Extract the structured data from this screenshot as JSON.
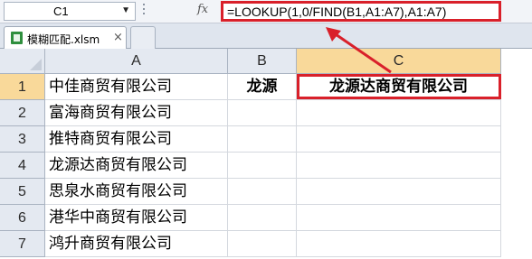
{
  "formula_bar": {
    "name_box": "C1",
    "dropdown_glyph": "▼",
    "fx_label": "fx",
    "formula": "=LOOKUP(1,0/FIND(B1,A1:A7),A1:A7)"
  },
  "tabs": {
    "active": {
      "label": "模糊匹配.xlsm",
      "close_glyph": "×"
    }
  },
  "columns": [
    "A",
    "B",
    "C"
  ],
  "rows": [
    {
      "num": "1",
      "A": "中佳商贸有限公司",
      "B": "龙源",
      "C": "龙源达商贸有限公司"
    },
    {
      "num": "2",
      "A": "富海商贸有限公司",
      "B": "",
      "C": ""
    },
    {
      "num": "3",
      "A": "推特商贸有限公司",
      "B": "",
      "C": ""
    },
    {
      "num": "4",
      "A": "龙源达商贸有限公司",
      "B": "",
      "C": ""
    },
    {
      "num": "5",
      "A": "思泉水商贸有限公司",
      "B": "",
      "C": ""
    },
    {
      "num": "6",
      "A": "港华中商贸有限公司",
      "B": "",
      "C": ""
    },
    {
      "num": "7",
      "A": "鸿升商贸有限公司",
      "B": "",
      "C": ""
    }
  ],
  "selected_cell": "C1",
  "colors": {
    "highlight": "#d9202a",
    "header_selected": "#f9d99a"
  }
}
